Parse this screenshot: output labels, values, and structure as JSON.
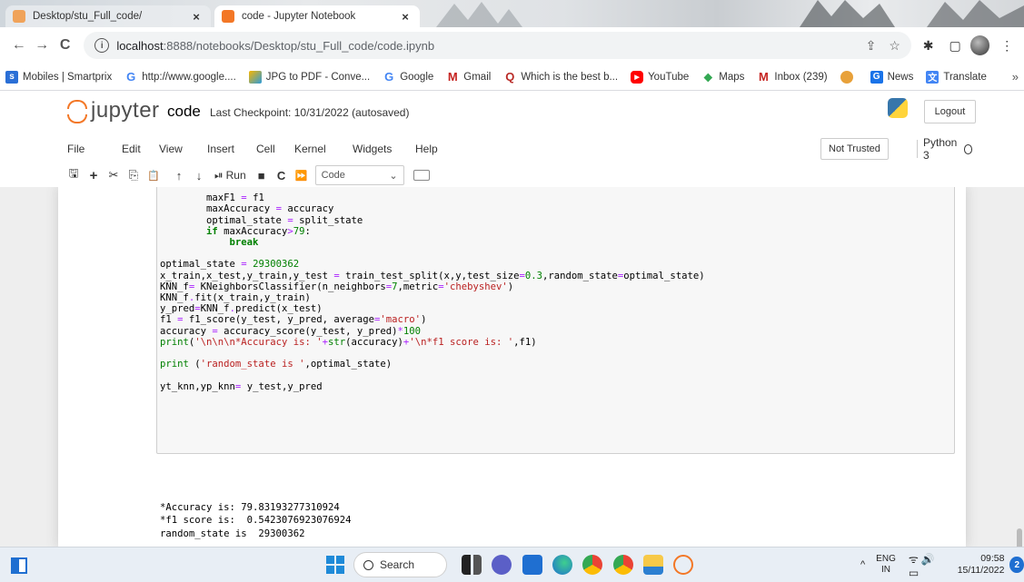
{
  "browser": {
    "tabs": [
      {
        "title": "Desktop/stu_Full_code/",
        "active": false
      },
      {
        "title": "code - Jupyter Notebook",
        "active": true
      }
    ],
    "tab_close_glyph": "×",
    "url_host": "localhost",
    "url_path": ":8888/notebooks/Desktop/stu_Full_code/code.ipynb",
    "icons": {
      "back": "arrow-left-icon",
      "forward": "arrow-right-icon",
      "reload": "reload-icon",
      "share": "share-icon",
      "star": "star-icon",
      "extensions": "puzzle-icon",
      "sidepanel": "sidepanel-icon",
      "menu": "kebab-menu-icon"
    }
  },
  "bookmarks": [
    {
      "label": "Mobiles | Smartprix",
      "icon": "smartprix-icon"
    },
    {
      "label": "http://www.google....",
      "icon": "google-icon"
    },
    {
      "label": "JPG to PDF - Conve...",
      "icon": "jpg2pdf-icon"
    },
    {
      "label": "Google",
      "icon": "google-icon"
    },
    {
      "label": "Gmail",
      "icon": "gmail-icon"
    },
    {
      "label": "Which is the best b...",
      "icon": "quora-icon"
    },
    {
      "label": "YouTube",
      "icon": "youtube-icon"
    },
    {
      "label": "Maps",
      "icon": "maps-icon"
    },
    {
      "label": "Inbox (239)",
      "icon": "gmail-icon"
    },
    {
      "label": "",
      "icon": "extension-icon"
    },
    {
      "label": "News",
      "icon": "news-icon"
    },
    {
      "label": "Translate",
      "icon": "translate-icon"
    }
  ],
  "bookmarks_more": "»",
  "jupyter": {
    "brand": "jupyter",
    "notebook_name": "code",
    "checkpoint": "Last Checkpoint: 10/31/2022  (autosaved)",
    "logout_label": "Logout",
    "menu": [
      "File",
      "Edit",
      "View",
      "Insert",
      "Cell",
      "Kernel",
      "Widgets",
      "Help"
    ],
    "trust_label": "Not Trusted",
    "kernel_name": "Python 3",
    "toolbar": {
      "run_label": "Run",
      "cell_type": "Code",
      "glyphs": {
        "save": "🖫",
        "add": "+",
        "cut": "✂",
        "copy": "⎘",
        "paste": "📋",
        "up": "↑",
        "down": "↓",
        "interrupt": "■",
        "restart": "C",
        "restart_run": "⏩",
        "run": "⏯",
        "dropdown": "⌄"
      }
    }
  },
  "cell": {
    "code_lines": [
      "        maxF1 = f1",
      "        maxAccuracy = accuracy",
      "        optimal_state = split_state",
      "        if maxAccuracy>79:",
      "            break",
      "",
      "optimal_state = 29300362",
      "x_train,x_test,y_train,y_test = train_test_split(x,y,test_size=0.3,random_state=optimal_state)",
      "KNN_f= KNeighborsClassifier(n_neighbors=7,metric='chebyshev')",
      "KNN_f.fit(x_train,y_train)",
      "y_pred=KNN_f.predict(x_test)",
      "f1 = f1_score(y_test, y_pred, average='macro')",
      "accuracy = accuracy_score(y_test, y_pred)*100",
      "print('\\n\\n\\n*Accuracy is: '+str(accuracy)+'\\n*f1 score is: ',f1)",
      "",
      "print ('random_state is ',optimal_state)",
      "",
      "yt_knn,yp_knn= y_test,y_pred"
    ],
    "output_lines": [
      "*Accuracy is: 79.83193277310924",
      "*f1 score is:  0.5423076923076924",
      "random_state is  29300362"
    ]
  },
  "taskbar": {
    "search_label": "Search",
    "lang_top": "ENG",
    "lang_bottom": "IN",
    "time": "09:58",
    "date": "15/11/2022",
    "notifications": "2",
    "tray_chevron": "^",
    "sys_glyphs": "ᯤ🔊▭"
  },
  "colors": {
    "jupyter_orange": "#f37726",
    "keyword_green": "#008000",
    "string_red": "#ba2121",
    "operator_purple": "#aa22ff"
  }
}
